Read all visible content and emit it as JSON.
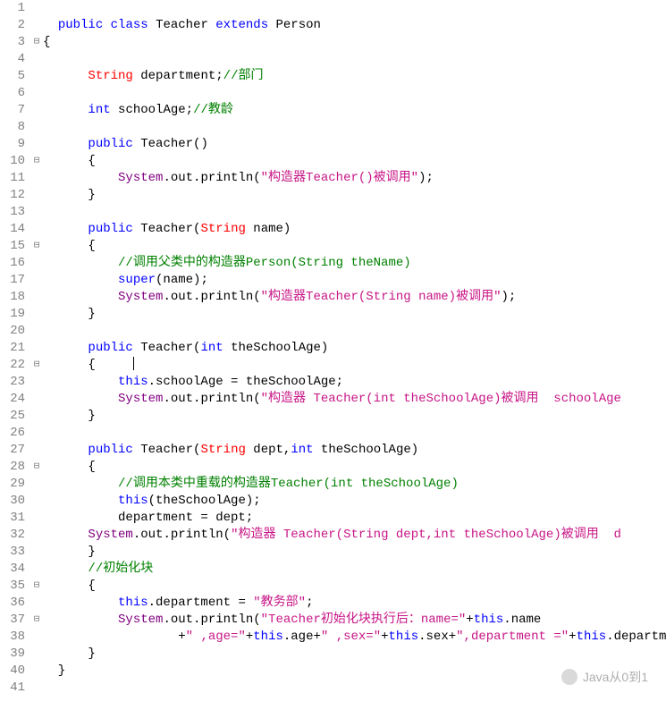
{
  "watermark": "Java从0到1",
  "lines": [
    {
      "n": 1,
      "f": "",
      "html": ""
    },
    {
      "n": 2,
      "f": "",
      "html": "  <span class='kw'>public</span> <span class='kw'>class</span> <span class='id'>Teacher</span> <span class='kw'>extends</span> <span class='id'>Person</span>"
    },
    {
      "n": 3,
      "f": "⊟",
      "html": "{"
    },
    {
      "n": 4,
      "f": "",
      "html": ""
    },
    {
      "n": 5,
      "f": "",
      "html": "      <span class='type'>String</span> department;<span class='com'>//部门</span>"
    },
    {
      "n": 6,
      "f": "",
      "html": ""
    },
    {
      "n": 7,
      "f": "",
      "html": "      <span class='kw'>int</span> schoolAge;<span class='com'>//教龄</span>"
    },
    {
      "n": 8,
      "f": "",
      "html": ""
    },
    {
      "n": 9,
      "f": "",
      "html": "      <span class='kw'>public</span> Teacher()"
    },
    {
      "n": 10,
      "f": "⊟",
      "html": "      {"
    },
    {
      "n": 11,
      "f": "",
      "html": "          <span class='purple'>System</span>.out.println(<span class='mag'>\"构造器Teacher()被调用\"</span>);"
    },
    {
      "n": 12,
      "f": "",
      "html": "      }"
    },
    {
      "n": 13,
      "f": "",
      "html": ""
    },
    {
      "n": 14,
      "f": "",
      "html": "      <span class='kw'>public</span> Teacher(<span class='type'>String</span> name)"
    },
    {
      "n": 15,
      "f": "⊟",
      "html": "      {"
    },
    {
      "n": 16,
      "f": "",
      "html": "          <span class='com'>//调用父类中的构造器Person(String theName)</span>"
    },
    {
      "n": 17,
      "f": "",
      "html": "          <span class='kw'>super</span>(name);"
    },
    {
      "n": 18,
      "f": "",
      "html": "          <span class='purple'>System</span>.out.println(<span class='mag'>\"构造器Teacher(String name)被调用\"</span>);"
    },
    {
      "n": 19,
      "f": "",
      "html": "      }"
    },
    {
      "n": 20,
      "f": "",
      "html": ""
    },
    {
      "n": 21,
      "f": "",
      "html": "      <span class='kw'>public</span> Teacher(<span class='kw'>int</span> theSchoolAge)"
    },
    {
      "n": 22,
      "f": "⊟",
      "html": "      {     <span class='cursor'></span>"
    },
    {
      "n": 23,
      "f": "",
      "html": "          <span class='kw'>this</span>.schoolAge = theSchoolAge;"
    },
    {
      "n": 24,
      "f": "",
      "html": "          <span class='purple'>System</span>.out.println(<span class='mag'>\"构造器 Teacher(int theSchoolAge)被调用  schoolAge</span>"
    },
    {
      "n": 25,
      "f": "",
      "html": "      }"
    },
    {
      "n": 26,
      "f": "",
      "html": ""
    },
    {
      "n": 27,
      "f": "",
      "html": "      <span class='kw'>public</span> Teacher(<span class='type'>String</span> dept,<span class='kw'>int</span> theSchoolAge)"
    },
    {
      "n": 28,
      "f": "⊟",
      "html": "      {"
    },
    {
      "n": 29,
      "f": "",
      "html": "          <span class='com'>//调用本类中重载的构造器Teacher(int theSchoolAge)</span>"
    },
    {
      "n": 30,
      "f": "",
      "html": "          <span class='kw'>this</span>(theSchoolAge);"
    },
    {
      "n": 31,
      "f": "",
      "html": "          department = dept;"
    },
    {
      "n": 32,
      "f": "",
      "html": "      <span class='purple'>System</span>.out.println(<span class='mag'>\"构造器 Teacher(String dept,int theSchoolAge)被调用  d</span>"
    },
    {
      "n": 33,
      "f": "",
      "html": "      }"
    },
    {
      "n": 34,
      "f": "",
      "html": "      <span class='com'>//初始化块</span>"
    },
    {
      "n": 35,
      "f": "⊟",
      "html": "      {"
    },
    {
      "n": 36,
      "f": "",
      "html": "          <span class='kw'>this</span>.department = <span class='mag'>\"教务部\"</span>;"
    },
    {
      "n": 37,
      "f": "⊟",
      "html": "          <span class='purple'>System</span>.out.println(<span class='mag'>\"Teacher初始化块执行后：name=\"</span>+<span class='kw'>this</span>.name"
    },
    {
      "n": 38,
      "f": "",
      "html": "                  +<span class='mag'>\" ,age=\"</span>+<span class='kw'>this</span>.age+<span class='mag'>\" ,sex=\"</span>+<span class='kw'>this</span>.sex+<span class='mag'>\",department =\"</span>+<span class='kw'>this</span>.departm"
    },
    {
      "n": 39,
      "f": "",
      "html": "      }"
    },
    {
      "n": 40,
      "f": "",
      "html": "  }"
    },
    {
      "n": 41,
      "f": "",
      "html": ""
    }
  ]
}
